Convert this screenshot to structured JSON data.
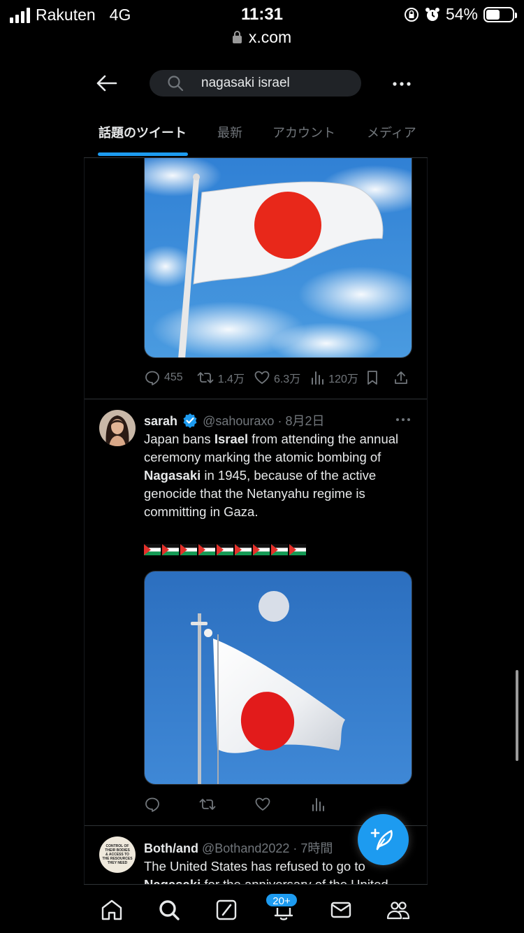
{
  "status_bar": {
    "carrier": "Rakuten",
    "network": "4G",
    "time": "11:31",
    "battery": "54%",
    "battery_level": 0.54,
    "url": "x.com"
  },
  "header": {
    "search_value": "nagasaki israel",
    "tabs": [
      "話題のツイート",
      "最新",
      "アカウント",
      "メディア"
    ],
    "active_tab": 0
  },
  "tweet_prev": {
    "stats": {
      "replies": "455",
      "retweets": "1.4万",
      "likes": "6.3万",
      "views": "120万"
    }
  },
  "tweet_sarah": {
    "name": "sarah",
    "handle": "@sahouraxo",
    "date": "8月2日",
    "verified": true,
    "text_parts": [
      {
        "t": "Japan bans ",
        "b": false
      },
      {
        "t": "Israel",
        "b": true
      },
      {
        "t": " from attending the annual ceremony marking the atomic bombing of ",
        "b": false
      },
      {
        "t": "Nagasaki",
        "b": true
      },
      {
        "t": " in 1945, because of the active genocide that the Netanyahu regime is committing in Gaza.",
        "b": false
      }
    ],
    "flag_emoji_count": 9
  },
  "tweet_both": {
    "name": "Both/and",
    "handle": "@Bothand2022",
    "date": "7時間",
    "avatar_text": [
      "CONTROL OF",
      "THEIR BODIES",
      "& ACCESS TO",
      "THE RESOURCES",
      "THEY NEED"
    ],
    "text_line1": "The United States has refused to go to",
    "text_line2_bold": "Nagasaki",
    "text_line2_rest": " for the anniversary of the United"
  },
  "bottom_nav": {
    "items": [
      "home-icon",
      "search-icon",
      "compose-tab-icon",
      "notifications-icon",
      "messages-icon",
      "communities-icon"
    ],
    "notification_badge": "20+"
  },
  "colors": {
    "accent": "#1d9bf0",
    "background": "#000000",
    "secondary_text": "#71767b",
    "divider": "#2f3336"
  }
}
